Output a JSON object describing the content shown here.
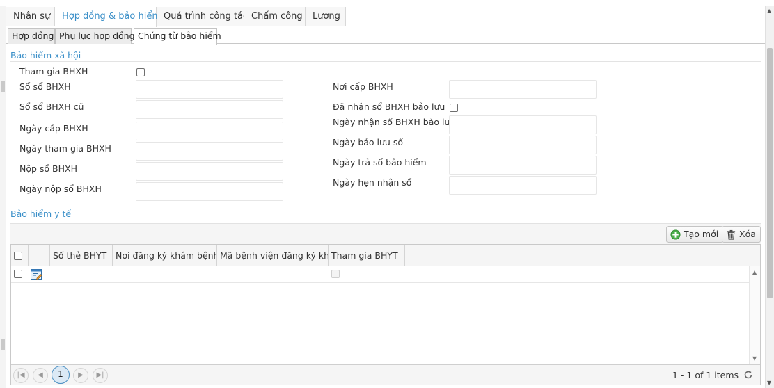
{
  "main_tabs": [
    {
      "label": "Nhân sự"
    },
    {
      "label": "Hợp đồng & bảo hiểm"
    },
    {
      "label": "Quá trình công tác"
    },
    {
      "label": "Chấm công"
    },
    {
      "label": "Lương"
    }
  ],
  "sub_tabs": [
    {
      "label": "Hợp đồng"
    },
    {
      "label": "Phụ lục hợp đồng"
    },
    {
      "label": "Chứng từ bảo hiểm"
    }
  ],
  "bhxh": {
    "title": "Bảo hiểm xã hội",
    "tham_gia": "Tham gia BHXH",
    "so_so": "Sổ sổ BHXH",
    "so_so_cu": "Sổ sổ BHXH cũ",
    "ngay_cap": "Ngày cấp BHXH",
    "ngay_tham_gia": "Ngày tham gia BHXH",
    "nop_so": "Nộp sổ BHXH",
    "ngay_nop_so": "Ngày nộp sổ BHXH",
    "noi_cap": "Nơi cấp BHXH",
    "da_nhan_so": "Đã nhận sổ BHXH bảo lưu",
    "ngay_nhan_so": "Ngày nhận sổ BHXH bảo lưu",
    "ngay_bao_luu": "Ngày bảo lưu sổ",
    "ngay_tra_so": "Ngày trả sổ bảo hiểm",
    "ngay_hen": "Ngày hẹn nhận sổ"
  },
  "bhyt": {
    "title": "Bảo hiểm y tế",
    "create_label": "Tạo mới",
    "delete_label": "Xóa",
    "columns": [
      "Số thẻ BHYT",
      "Nơi đăng ký khám bệnh",
      "Mã bệnh viện đăng ký khám",
      "Tham gia BHYT"
    ]
  },
  "pager": {
    "current_page": "1",
    "info": "1 - 1 of 1 items"
  },
  "colors": {
    "accent": "#3a8fc8",
    "create_icon": "#4cae4c"
  }
}
